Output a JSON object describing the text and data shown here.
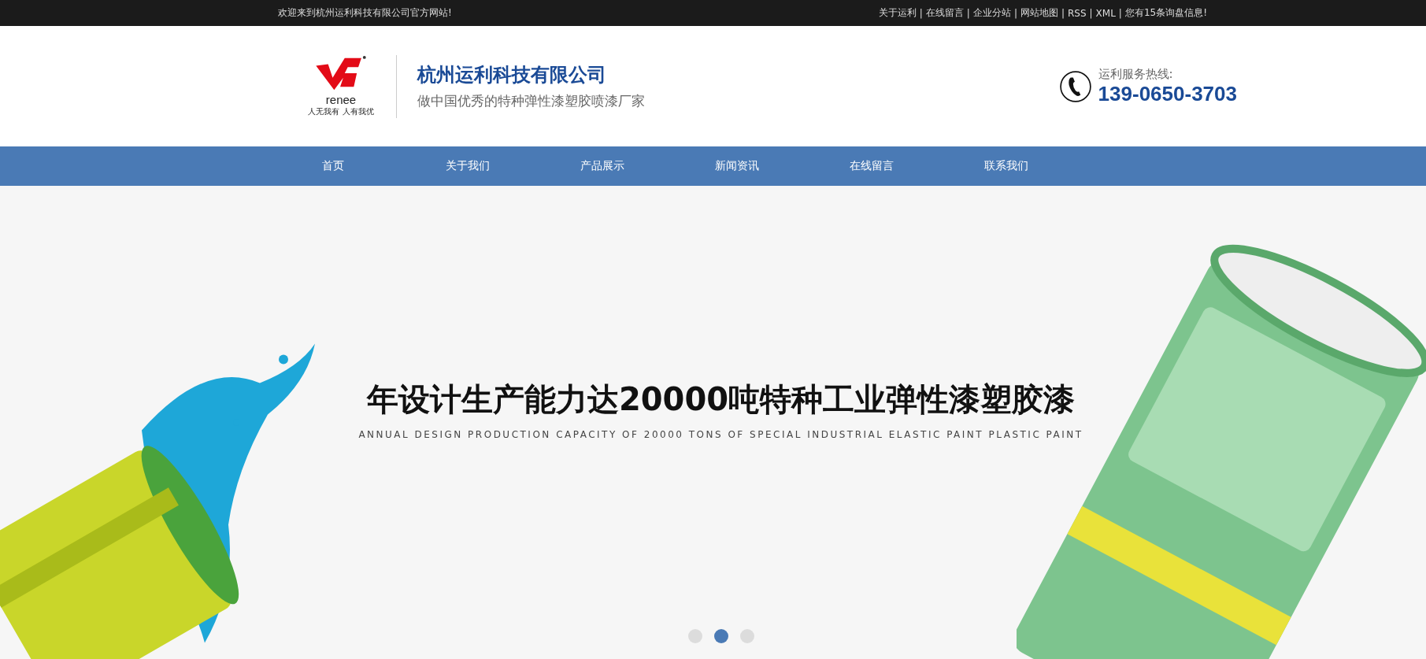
{
  "top_bar": {
    "welcome": "欢迎来到杭州运利科技有限公司官方网站!",
    "separator": "|",
    "links": [
      "关于运利",
      "在线留言",
      "企业分站",
      "网站地图",
      "RSS",
      "XML",
      "您有15条询盘信息!"
    ]
  },
  "header": {
    "logo_word": "renee",
    "logo_slogan": "人无我有 人有我优",
    "company": "杭州运利科技有限公司",
    "tagline": "做中国优秀的特种弹性漆塑胶喷漆厂家",
    "hotline_label": "运利服务热线:",
    "hotline": "139-0650-3703"
  },
  "nav": [
    {
      "label": "首页"
    },
    {
      "label": "关于我们"
    },
    {
      "label": "产品展示"
    },
    {
      "label": "新闻资讯"
    },
    {
      "label": "在线留言"
    },
    {
      "label": "联系我们"
    }
  ],
  "banner": {
    "title": "年设计生产能力达20000吨特种工业弹性漆塑胶漆",
    "subtitle": "ANNUAL DESIGN PRODUCTION CAPACITY OF 20000 TONS OF SPECIAL INDUSTRIAL ELASTIC PAINT PLASTIC PAINT",
    "dots": [
      {
        "selected": false
      },
      {
        "selected": true
      },
      {
        "selected": false
      }
    ]
  }
}
